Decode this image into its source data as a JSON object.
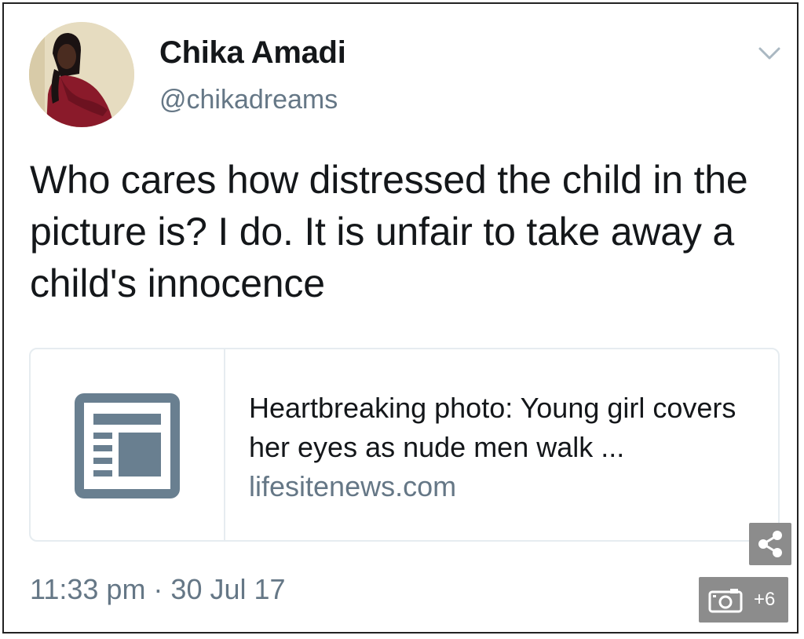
{
  "tweet": {
    "author_name": "Chika Amadi",
    "author_handle": "@chikadreams",
    "text": "Who cares how distressed the child in the picture is? I do. It is unfair to take away a child's innocence",
    "timestamp": "11:33 pm · 30 Jul 17"
  },
  "card": {
    "title": "Heartbreaking photo: Young girl covers her eyes as nude men walk ...",
    "domain": "lifesitenews.com",
    "icon": "newspaper-icon"
  },
  "overlay": {
    "share_icon": "share-icon",
    "camera_icon": "camera-icon",
    "gallery_count": "+6"
  },
  "colors": {
    "text": "#14171a",
    "secondary_text": "#657786",
    "card_border": "#e6ecf0",
    "card_icon": "#697f90",
    "overlay_button": "#8c8c8c"
  }
}
